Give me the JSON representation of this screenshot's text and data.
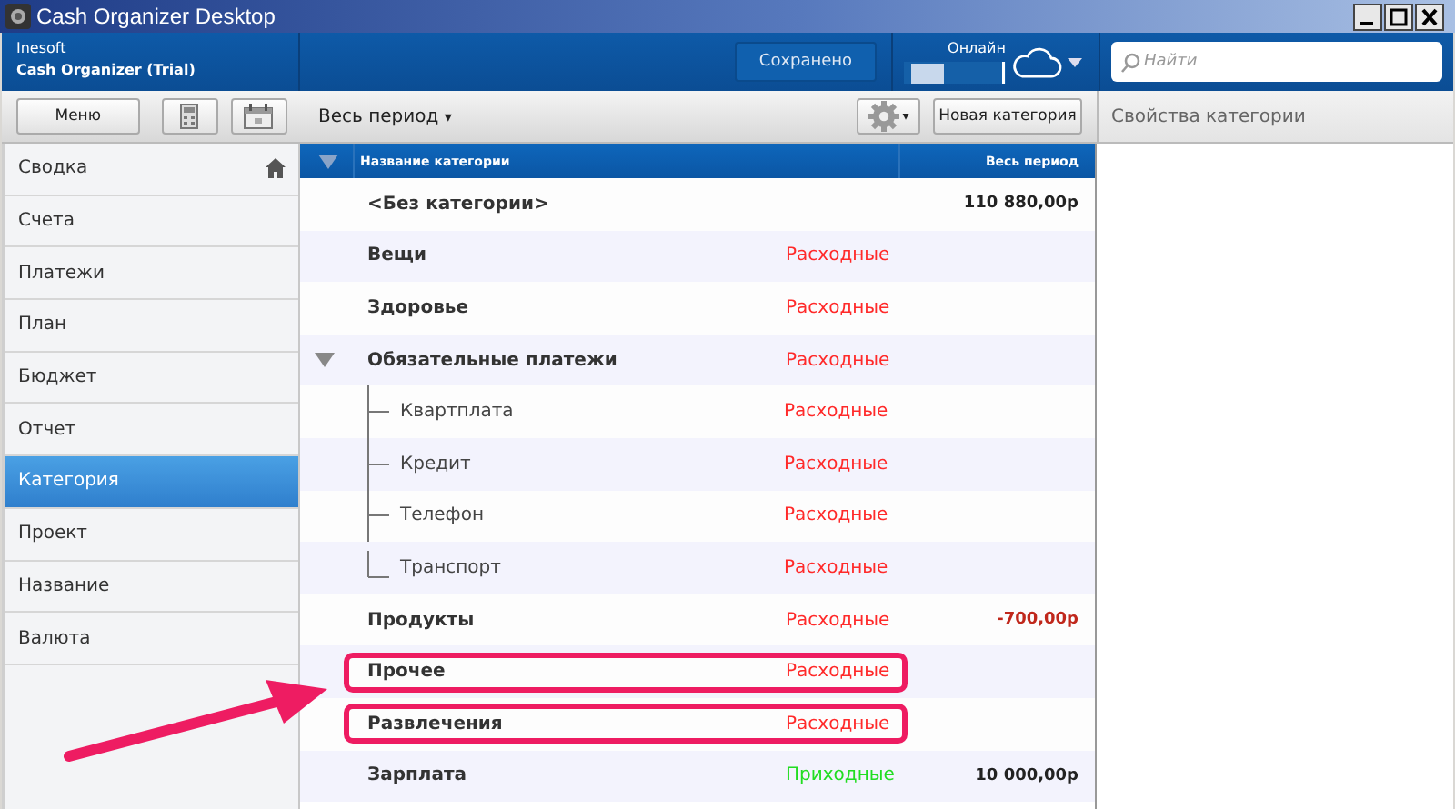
{
  "window": {
    "title": "Cash Organizer Desktop"
  },
  "header": {
    "company": "Inesoft",
    "product": "Cash Organizer (Trial)",
    "save_status": "Сохранено",
    "online_label": "Онлайн",
    "search": {
      "placeholder": "Найти"
    }
  },
  "toolbar": {
    "menu_button": "Меню",
    "period": "Весь период",
    "period_caret": "▾",
    "gear_caret": "▾",
    "new_button": "Новая категория"
  },
  "sidebar": {
    "items": [
      {
        "label": "Сводка",
        "selected": false,
        "home": true
      },
      {
        "label": "Счета",
        "selected": false,
        "home": false
      },
      {
        "label": "Платежи",
        "selected": false,
        "home": false
      },
      {
        "label": "План",
        "selected": false,
        "home": false
      },
      {
        "label": "Бюджет",
        "selected": false,
        "home": false
      },
      {
        "label": "Отчет",
        "selected": false,
        "home": false
      },
      {
        "label": "Категория",
        "selected": true,
        "home": false
      },
      {
        "label": "Проект",
        "selected": false,
        "home": false
      },
      {
        "label": "Название",
        "selected": false,
        "home": false
      },
      {
        "label": "Валюта",
        "selected": false,
        "home": false
      }
    ]
  },
  "table": {
    "columns": [
      "Название категории",
      "Весь период"
    ],
    "rows": [
      {
        "name": "<Без категории>",
        "amount": {
          "text": "110 880,00р",
          "color": "#222222"
        },
        "highlighted": false
      },
      {
        "name": "Вещи",
        "type": {
          "text": "Расходные",
          "color": "#ff2a2a"
        },
        "highlighted": false
      },
      {
        "name": "Здоровье",
        "type": {
          "text": "Расходные",
          "color": "#ff2a2a"
        },
        "highlighted": false
      },
      {
        "name": "Обязательные платежи",
        "type": {
          "text": "Расходные",
          "color": "#ff2a2a"
        },
        "highlighted": false,
        "expanded": true,
        "children": [
          {
            "name": "Квартплата",
            "type": {
              "text": "Расходные",
              "color": "#ff2a2a"
            },
            "highlighted": false
          },
          {
            "name": "Кредит",
            "type": {
              "text": "Расходные",
              "color": "#ff2a2a"
            },
            "highlighted": false
          },
          {
            "name": "Телефон",
            "type": {
              "text": "Расходные",
              "color": "#ff2a2a"
            },
            "highlighted": false
          },
          {
            "name": "Транспорт",
            "type": {
              "text": "Расходные",
              "color": "#ff2a2a"
            },
            "highlighted": false
          }
        ]
      },
      {
        "name": "Продукты",
        "type": {
          "text": "Расходные",
          "color": "#ff2a2a"
        },
        "amount": {
          "text": "-700,00р",
          "color": "#c0281c"
        },
        "highlighted": false
      },
      {
        "name": "Прочее",
        "type": {
          "text": "Расходные",
          "color": "#ff2a2a"
        },
        "highlighted": true
      },
      {
        "name": "Развлечения",
        "type": {
          "text": "Расходные",
          "color": "#ff2a2a"
        },
        "highlighted": true
      },
      {
        "name": "Зарплата",
        "type": {
          "text": "Приходные",
          "color": "#22dd22"
        },
        "amount": {
          "text": "10 000,00р",
          "color": "#222222"
        },
        "highlighted": false
      }
    ]
  },
  "properties_panel": {
    "title": "Свойства категории"
  }
}
